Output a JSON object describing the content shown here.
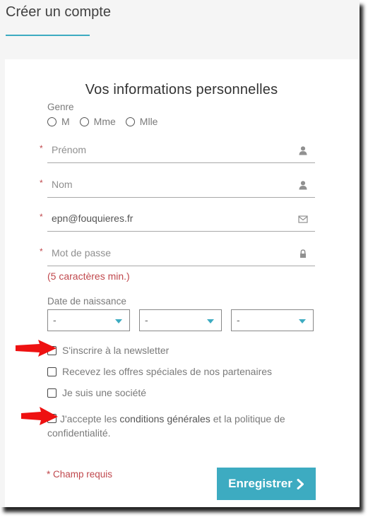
{
  "page": {
    "title": "Créer un compte"
  },
  "section": {
    "title": "Vos informations personnelles"
  },
  "genre": {
    "label": "Genre",
    "options": [
      "M",
      "Mme",
      "Mlle"
    ]
  },
  "fields": {
    "required_mark": "*",
    "prenom": {
      "placeholder": "Prénom",
      "value": "",
      "icon": "user-icon"
    },
    "nom": {
      "placeholder": "Nom",
      "value": "",
      "icon": "user-icon"
    },
    "email": {
      "placeholder": "",
      "value": "epn@fouquieres.fr",
      "icon": "envelope-icon"
    },
    "password": {
      "placeholder": "Mot de passe",
      "value": "",
      "icon": "lock-icon",
      "hint": "(5 caractères min.)"
    }
  },
  "birthdate": {
    "label": "Date de naissance",
    "day": "-",
    "month": "-",
    "year": "-"
  },
  "checkboxes": {
    "newsletter": "S'inscrire à la newsletter",
    "partners": "Recevez les offres spéciales de nos partenaires",
    "company": "Je suis une société"
  },
  "terms": {
    "prefix": "J'accepte les ",
    "link": "conditions générales",
    "suffix": " et la politique de confidentialité."
  },
  "footer": {
    "required_note": "* Champ requis",
    "save_label": "Enregistrer"
  },
  "colors": {
    "accent": "#3dabc1",
    "required": "#c0484d",
    "annotation_arrow": "#ee1111"
  }
}
